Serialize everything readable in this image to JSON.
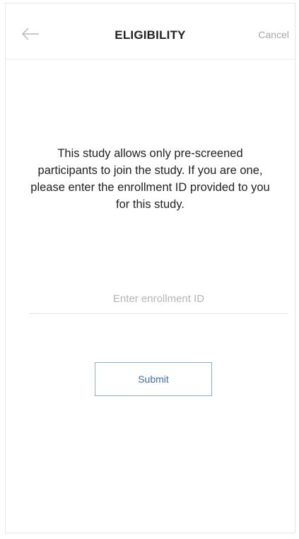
{
  "navbar": {
    "title": "ELIGIBILITY",
    "cancel_label": "Cancel",
    "back_icon": "arrow-left-icon"
  },
  "content": {
    "message": "This study allows only pre-screened participants to join the study. If you are one, please enter the enrollment ID provided to you for this study."
  },
  "form": {
    "enrollment_id_value": "",
    "enrollment_id_placeholder": "Enter enrollment ID",
    "submit_label": "Submit"
  },
  "colors": {
    "accent": "#3d6fa8",
    "button_border": "#8ab0d8",
    "muted_text": "#a8a8a8"
  }
}
